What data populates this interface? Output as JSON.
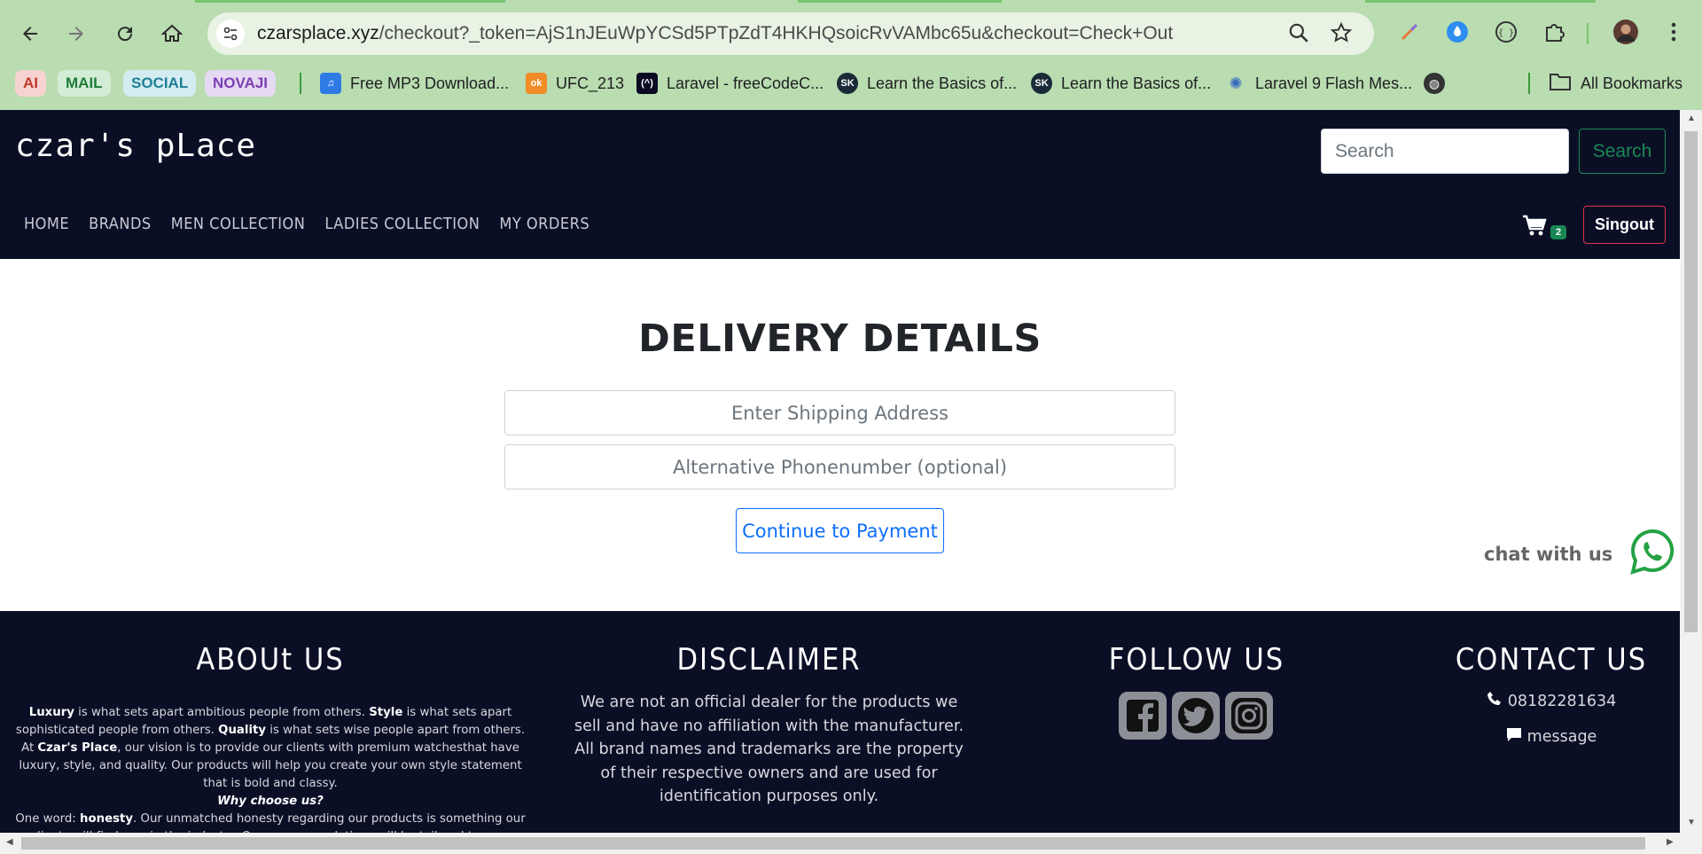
{
  "browser": {
    "url_host": "czarsplace.xyz",
    "url_path": "/checkout?_token=AjS1nJEuWpYCSd5PTpZdT4HKHQsoicRvVAMbc65u&checkout=Check+Out",
    "bookmark_chips": [
      {
        "label": "AI",
        "color": "#c0392b",
        "bg": "#f6d3d0"
      },
      {
        "label": "MAIL",
        "color": "#1e7d3a",
        "bg": "#d3ecd6"
      },
      {
        "label": "SOCIAL",
        "color": "#1f7e95",
        "bg": "#d2ecf1"
      },
      {
        "label": "NOVAJI",
        "color": "#7b3fb5",
        "bg": "#e6d9f3"
      }
    ],
    "bookmarks": [
      {
        "label": "Free MP3 Download...",
        "icon": "music-icon"
      },
      {
        "label": "UFC_213",
        "icon": "ok-icon"
      },
      {
        "label": "Laravel - freeCodeC...",
        "icon": "freecodecamp-icon"
      },
      {
        "label": "Learn the Basics of...",
        "icon": "sk-icon"
      },
      {
        "label": "Learn the Basics of...",
        "icon": "sk-icon"
      },
      {
        "label": "Laravel 9 Flash Mes...",
        "icon": "lightbulb-icon"
      }
    ],
    "all_bookmarks": "All Bookmarks"
  },
  "site": {
    "brand": "czar's pLace",
    "search_placeholder": "Search",
    "search_button": "Search",
    "menu": [
      "HOME",
      "BRANDS",
      "MEN COLLECTION",
      "LADIES COLLECTION",
      "MY ORDERS"
    ],
    "cart_count": "2",
    "signout": "Singout"
  },
  "checkout": {
    "title": "DELIVERY DETAILS",
    "address_placeholder": "Enter Shipping Address",
    "phone_placeholder": "Alternative Phonenumber (optional)",
    "continue_button": "Continue to Payment",
    "chat_label": "chat with us"
  },
  "footer": {
    "about_title": "ABOUt US",
    "about_p1_b1": "Luxury",
    "about_p1_t1": " is what sets apart ambitious people from others. ",
    "about_p1_b2": "Style",
    "about_p1_t2": " is what sets apart sophisticated people from others. ",
    "about_p1_b3": "Quality",
    "about_p1_t3": " is what sets wise people apart from others. At ",
    "about_p1_b4": "Czar's Place",
    "about_p1_t4": ", our vision is to provide our clients with premium watchesthat have luxury, style, and quality. Our products will help you create your own style statement that is bold and classy.",
    "why_title": "Why choose us?",
    "about_p2_t1": "One word: ",
    "about_p2_b1": "honesty",
    "about_p2_t2": ". Our unmatched honesty regarding our products is something our clients will find rare in the industry. Our recommendations will be tailored to your needs, and we will help",
    "disclaimer_title": "DISCLAIMER",
    "disclaimer_text": "We are not an official dealer for the products we sell and have no affiliation with the manufacturer. All brand names and trademarks are the property of their respective owners and are used for identification purposes only.",
    "follow_title": "FOLLOW US",
    "contact_title": "CONTACT US",
    "phone": "08182281634",
    "message": "message"
  },
  "colors": {
    "navbar_bg": "#0b0f26",
    "chrome_bg": "#b9dcb1",
    "success": "#198754",
    "danger": "#dc3545",
    "primary": "#0d6efd",
    "whatsapp": "#25a244"
  }
}
